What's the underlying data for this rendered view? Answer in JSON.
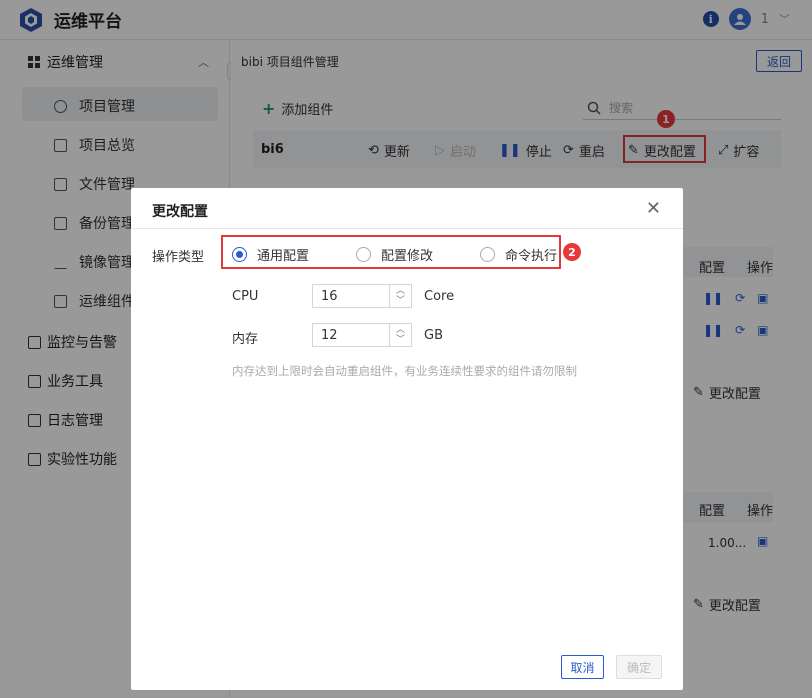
{
  "app": {
    "title": "运维平台",
    "user_num": "1"
  },
  "sidebar": {
    "groups": [
      {
        "label": "运维管理"
      },
      {
        "label": "监控与告警"
      },
      {
        "label": "业务工具"
      },
      {
        "label": "日志管理"
      },
      {
        "label": "实验性功能"
      }
    ],
    "items": [
      {
        "label": "项目管理"
      },
      {
        "label": "项目总览"
      },
      {
        "label": "文件管理"
      },
      {
        "label": "备份管理"
      },
      {
        "label": "镜像管理"
      },
      {
        "label": "运维组件"
      }
    ]
  },
  "main": {
    "breadcrumb": "bibi 项目组件管理",
    "back_label": "返回",
    "add_component": "添加组件",
    "search_placeholder": "搜索",
    "card": {
      "name": "bi6",
      "actions": {
        "update": "更新",
        "start": "启动",
        "stop": "停止",
        "restart": "重启",
        "change_config": "更改配置",
        "scale": "扩容"
      }
    },
    "bg": {
      "config_col": "配置",
      "op_col": "操作",
      "change_config_2": "更改配置",
      "change_config_3": "更改配置",
      "config_col_2": "配置",
      "op_col_2": "操作",
      "row_value": "1.00..."
    }
  },
  "badges": {
    "one": "1",
    "two": "2"
  },
  "modal": {
    "title": "更改配置",
    "op_type_label": "操作类型",
    "radios": [
      {
        "label": "通用配置",
        "checked": true
      },
      {
        "label": "配置修改",
        "checked": false
      },
      {
        "label": "命令执行",
        "checked": false
      }
    ],
    "cpu": {
      "label": "CPU",
      "value": "16",
      "unit": "Core"
    },
    "mem": {
      "label": "内存",
      "value": "12",
      "unit": "GB"
    },
    "hint": "内存达到上限时会自动重启组件，有业务连续性要求的组件请勿限制",
    "cancel": "取消",
    "ok": "确定"
  },
  "colors": {
    "primary": "#2b5bd0",
    "highlight": "#e23a3a",
    "add": "#1aa15d"
  }
}
